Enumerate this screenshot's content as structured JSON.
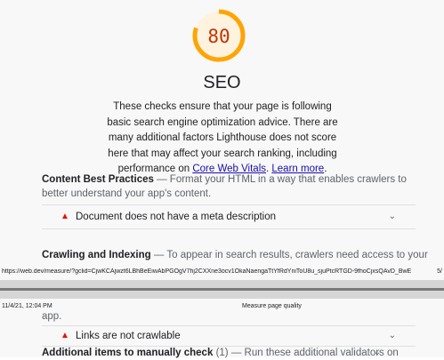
{
  "report": {
    "score": "80",
    "category_title": "SEO",
    "score_color": "#ffa400",
    "description": "These checks ensure that your page is following basic search engine optimization advice. There are many additional factors Lighthouse does not score here that may affect your search ranking, including performance on",
    "link_core_web_vitals": "Core Web Vitals",
    "link_learn_more": "Learn more",
    "groups": [
      {
        "title": "Content Best Practices",
        "description": "— Format your HTML in a way that enables crawlers to better understand your app's content.",
        "audits": [
          "Document does not have a meta description"
        ]
      },
      {
        "title": "Crawling and Indexing",
        "description": "— To appear in search results, crawlers need access to your",
        "continuation": "app.",
        "audits": [
          "Links are not crawlable"
        ]
      },
      {
        "title": "Additional items to manually check",
        "count": "(1)",
        "description": "— Run these additional validators on"
      }
    ]
  },
  "print_footer": {
    "url": "https://web.dev/measure/?gclid=CjwKCAjwzt6LBhBeEiwAbPGOgV7hj2CXXne3ocv1OkaNaengaTtYfRdYniToU8u_sjuPtcRTGD-9fhoCjxsQAvD_BwE",
    "page": "5/"
  },
  "print_header": {
    "date": "11/4/21, 12:04 PM",
    "title": "Measure page quality"
  }
}
